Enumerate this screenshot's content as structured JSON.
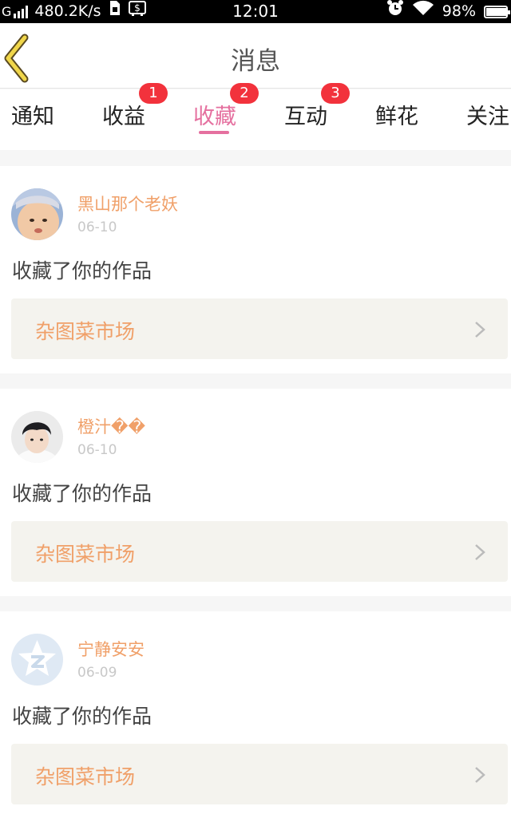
{
  "status_bar": {
    "network": "G",
    "speed": "480.2K/s",
    "time": "12:01",
    "battery": "98%",
    "battery_level": 0.98
  },
  "header": {
    "title": "消息"
  },
  "tabs": [
    {
      "label": "通知",
      "badge": ""
    },
    {
      "label": "收益",
      "badge": "1"
    },
    {
      "label": "收藏",
      "badge": "2",
      "active": true
    },
    {
      "label": "互动",
      "badge": "3"
    },
    {
      "label": "鲜花",
      "badge": ""
    },
    {
      "label": "关注",
      "badge": ""
    }
  ],
  "items": [
    {
      "user": "黑山那个老妖",
      "date": "06-10",
      "action": "收藏了你的作品",
      "album": "杂图菜市场",
      "avatar": "child-photo"
    },
    {
      "user": "橙汁��",
      "date": "06-10",
      "action": "收藏了你的作品",
      "album": "杂图菜市场",
      "avatar": "boy-portrait"
    },
    {
      "user": "宁静安安",
      "date": "06-09",
      "action": "收藏了你的作品",
      "album": "杂图菜市场",
      "avatar": "qzone-default-icon"
    }
  ],
  "colors": {
    "accent": "#e5709f",
    "badge": "#f2323c",
    "username": "#f0a069",
    "back_arrow": "#f0d64a"
  }
}
